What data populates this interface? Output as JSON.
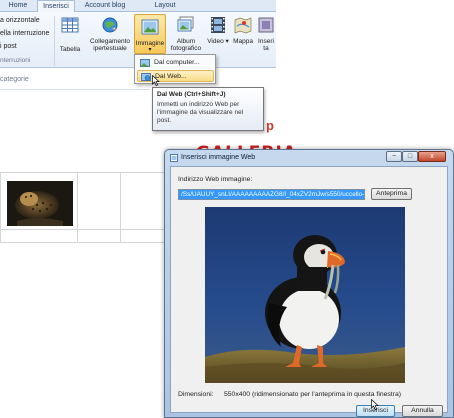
{
  "ribbon": {
    "tabs": [
      {
        "label": "Home"
      },
      {
        "label": "Inserisci"
      },
      {
        "label": "Account blog"
      },
      {
        "label": "Layout"
      }
    ],
    "left_items": [
      "a orizzontale",
      "ella interruzione",
      "i post"
    ],
    "left_group_label": "nterruzioni",
    "buttons": {
      "tabella": "Tabella",
      "collegamento": "Collegamento ipertestuale",
      "immagine": "Immagine",
      "album": "Album fotografico",
      "video": "Video",
      "mappa": "Mappa",
      "inserisci_cut": "Inseri ta"
    }
  },
  "dropdown": {
    "items": [
      {
        "label": "Dal computer..."
      },
      {
        "label": "Dal Web..."
      }
    ]
  },
  "tooltip": {
    "title": "Dal Web (Ctrl+Shift+J)",
    "body": "Immetti un indirizzo Web per l'immagine da visualizzare nel post."
  },
  "editor": {
    "categories_placeholder": "categorie",
    "galleria_text": "GALLERIA",
    "partial_p": "p"
  },
  "dialog": {
    "title": "Inserisci immagine Web",
    "window_buttons": {
      "minimize": "−",
      "maximize": "□",
      "close": "x"
    },
    "url_label": "Indirizzo Web immagine:",
    "url_value": "/Ss/UAUUY_snLI/AAAAAAAAAZG8/I_04xZV2mJw/s550/uccello-pesce.jpg",
    "preview_button": "Anteprima",
    "dimensions_label": "Dimensioni:",
    "dimensions_value": "550x400 (ridimensionato per l'anteprima in questa finestra)",
    "insert_button": "Inserisci",
    "cancel_button": "Annulla"
  },
  "colors": {
    "accent_red": "#cc1f1f",
    "selection_blue": "#3399ff",
    "highlight_gold": "#f7c95b"
  }
}
